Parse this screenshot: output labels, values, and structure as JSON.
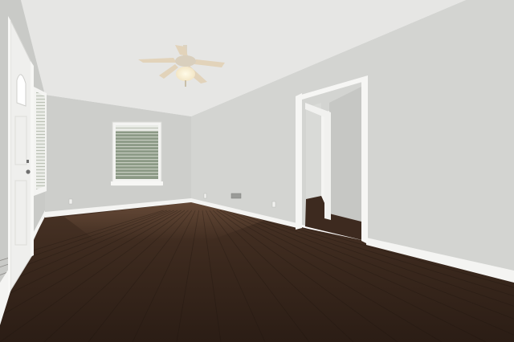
{
  "scene": {
    "subject": "empty-room-interior",
    "colors": {
      "ceiling": "#e6e6e4",
      "wall_left": "#c9cac7",
      "wall_back": "#cdcecb",
      "wall_right": "#d3d4d1",
      "floor_dark": "#2b1d15",
      "floor_mid": "#4a3426",
      "floor_light": "#6a4c38",
      "trim": "#f4f4f2",
      "door": "#efefed",
      "window_glass": "#8c9a86",
      "fan_blade": "#e2d3ba",
      "fan_light": "#fffbe8"
    },
    "icons": [
      "ceiling-fan-icon",
      "door-knob-icon",
      "floor-vent-icon",
      "outlet-icon"
    ]
  }
}
